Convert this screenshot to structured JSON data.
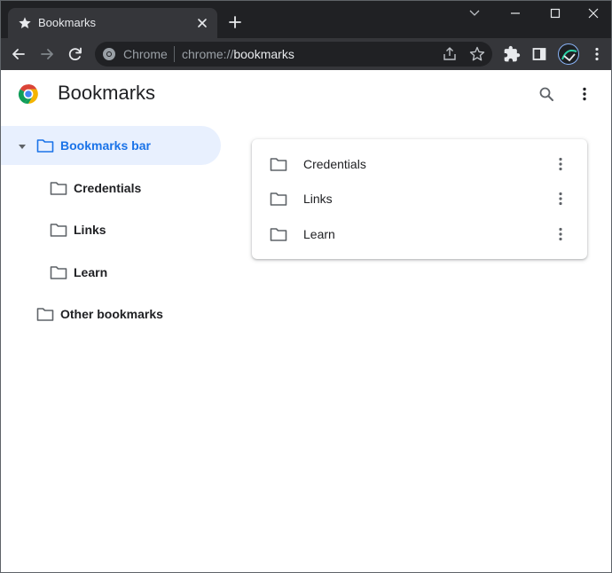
{
  "window": {
    "tab_title": "Bookmarks",
    "controls": [
      "chevron-down-icon",
      "minimize-icon",
      "maximize-icon",
      "close-icon"
    ]
  },
  "toolbar": {
    "omnibox_chip": "Chrome",
    "url_scheme": "chrome://",
    "url_host": "bookmarks"
  },
  "header": {
    "title": "Bookmarks"
  },
  "sidebar": {
    "items": [
      {
        "label": "Bookmarks bar",
        "selected": true,
        "expanded": true
      },
      {
        "label": "Credentials"
      },
      {
        "label": "Links"
      },
      {
        "label": "Learn"
      },
      {
        "label": "Other bookmarks"
      }
    ]
  },
  "list": {
    "items": [
      {
        "label": "Credentials"
      },
      {
        "label": "Links"
      },
      {
        "label": "Learn"
      }
    ]
  },
  "colors": {
    "frame": "#202124",
    "toolbar": "#35363a",
    "accent": "#1a73e8",
    "selected_bg": "#e8f0fe"
  }
}
